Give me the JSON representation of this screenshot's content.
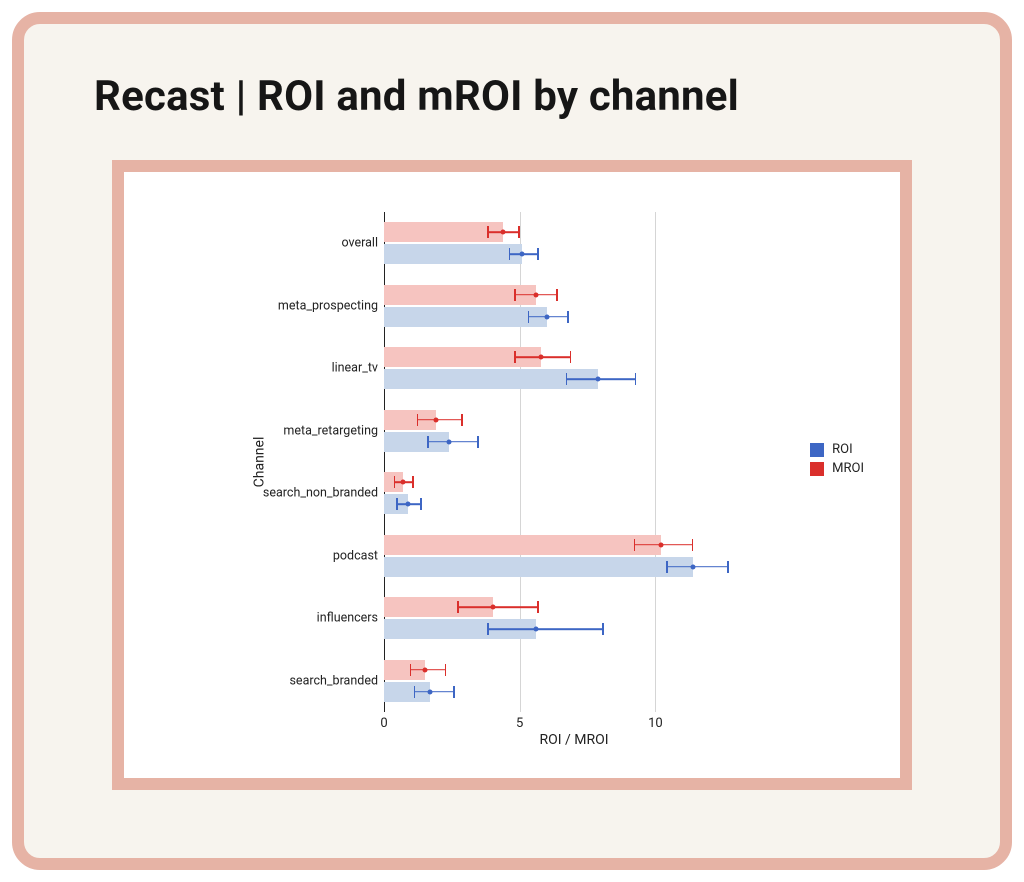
{
  "title": "Recast | ROI and mROI by channel",
  "legend": {
    "roi": "ROI",
    "mroi": "MROI"
  },
  "chart_data": {
    "type": "bar",
    "orientation": "horizontal",
    "xlabel": "ROI / MROI",
    "ylabel": "Channel",
    "xlim": [
      0,
      14
    ],
    "xticks": [
      0,
      5,
      10
    ],
    "categories": [
      "overall",
      "meta_prospecting",
      "linear_tv",
      "meta_retargeting",
      "search_non_branded",
      "podcast",
      "influencers",
      "search_branded"
    ],
    "series": [
      {
        "name": "MROI",
        "color_bar": "#f6c4c0",
        "color_err": "#da2f2b",
        "values": [
          4.4,
          5.6,
          5.8,
          1.9,
          0.7,
          10.2,
          4.0,
          1.5
        ],
        "err_low": [
          3.8,
          4.8,
          4.8,
          1.2,
          0.35,
          9.2,
          2.7,
          0.95
        ],
        "err_high": [
          5.0,
          6.4,
          6.9,
          2.9,
          1.1,
          11.4,
          5.7,
          2.3
        ]
      },
      {
        "name": "ROI",
        "color_bar": "#c7d6ea",
        "color_err": "#3d66c4",
        "values": [
          5.1,
          6.0,
          7.9,
          2.4,
          0.9,
          11.4,
          5.6,
          1.7
        ],
        "err_low": [
          4.6,
          5.3,
          6.7,
          1.6,
          0.45,
          10.4,
          3.8,
          1.1
        ],
        "err_high": [
          5.7,
          6.8,
          9.3,
          3.5,
          1.4,
          12.7,
          8.1,
          2.6
        ]
      }
    ]
  }
}
